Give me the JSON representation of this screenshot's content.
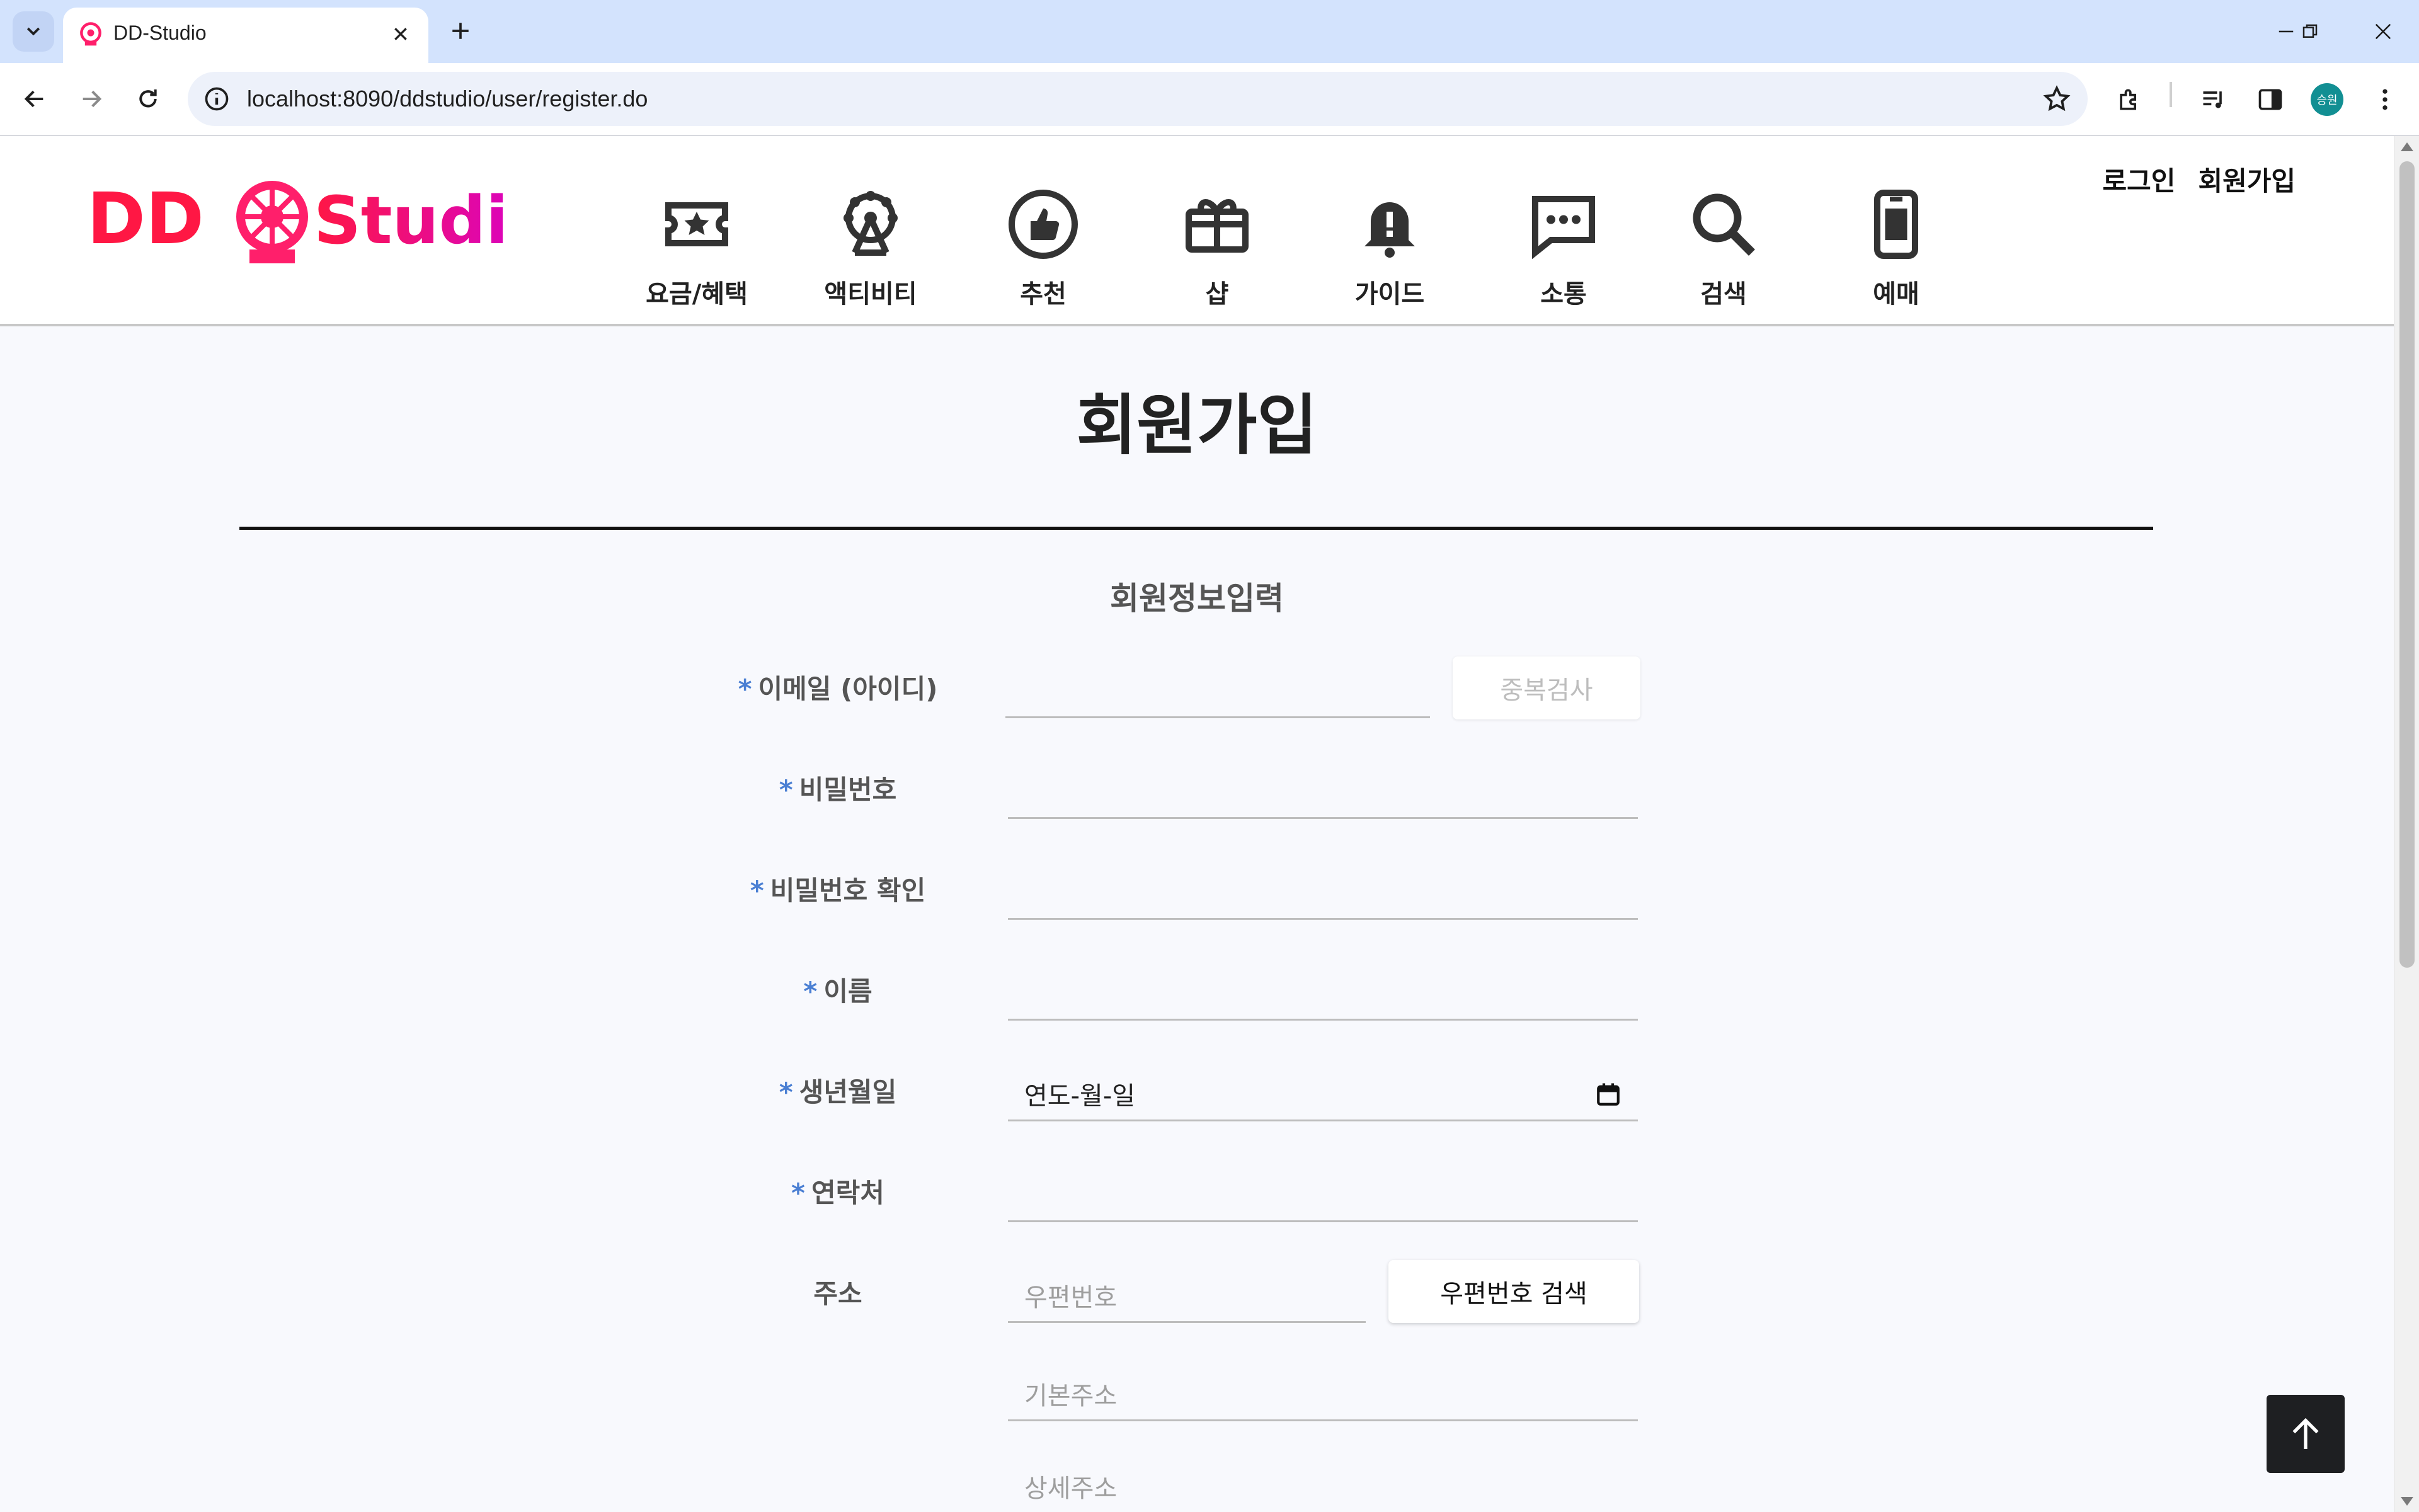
{
  "browser": {
    "tab_title": "DD-Studio",
    "url": "localhost:8090/ddstudio/user/register.do",
    "profile_initials": "승원"
  },
  "header": {
    "logo_text": "DD Studio",
    "auth": {
      "login": "로그인",
      "register": "회원가입"
    },
    "menu": [
      {
        "label": "요금/혜택",
        "icon": "ticket-star-icon"
      },
      {
        "label": "액티비티",
        "icon": "ferris-wheel-icon"
      },
      {
        "label": "추천",
        "icon": "thumbs-up-icon"
      },
      {
        "label": "샵",
        "icon": "gift-box-icon"
      },
      {
        "label": "가이드",
        "icon": "bell-alert-icon"
      },
      {
        "label": "소통",
        "icon": "chat-bubble-icon"
      },
      {
        "label": "검색",
        "icon": "search-icon"
      },
      {
        "label": "예매",
        "icon": "mobile-ticket-icon"
      }
    ]
  },
  "page": {
    "title": "회원가입",
    "section_title": "회원정보입력"
  },
  "form": {
    "required_mark": "*",
    "email": {
      "label": "이메일 (아이디)",
      "value": "",
      "check_button": "중복검사"
    },
    "password": {
      "label": "비밀번호",
      "value": ""
    },
    "password_confirm": {
      "label": "비밀번호 확인",
      "value": ""
    },
    "name": {
      "label": "이름",
      "value": ""
    },
    "birthdate": {
      "label": "생년월일",
      "value": "연도-월-일"
    },
    "phone": {
      "label": "연락처",
      "value": ""
    },
    "address": {
      "label": "주소",
      "zip_placeholder": "우편번호",
      "zip_search_button": "우편번호 검색",
      "base_placeholder": "기본주소",
      "detail_placeholder": "상세주소"
    }
  },
  "colors": {
    "brand_red": "#ff1744",
    "brand_magenta": "#d400d4",
    "required_blue": "#4a7fd3",
    "tabbar": "#d3e3fd"
  }
}
